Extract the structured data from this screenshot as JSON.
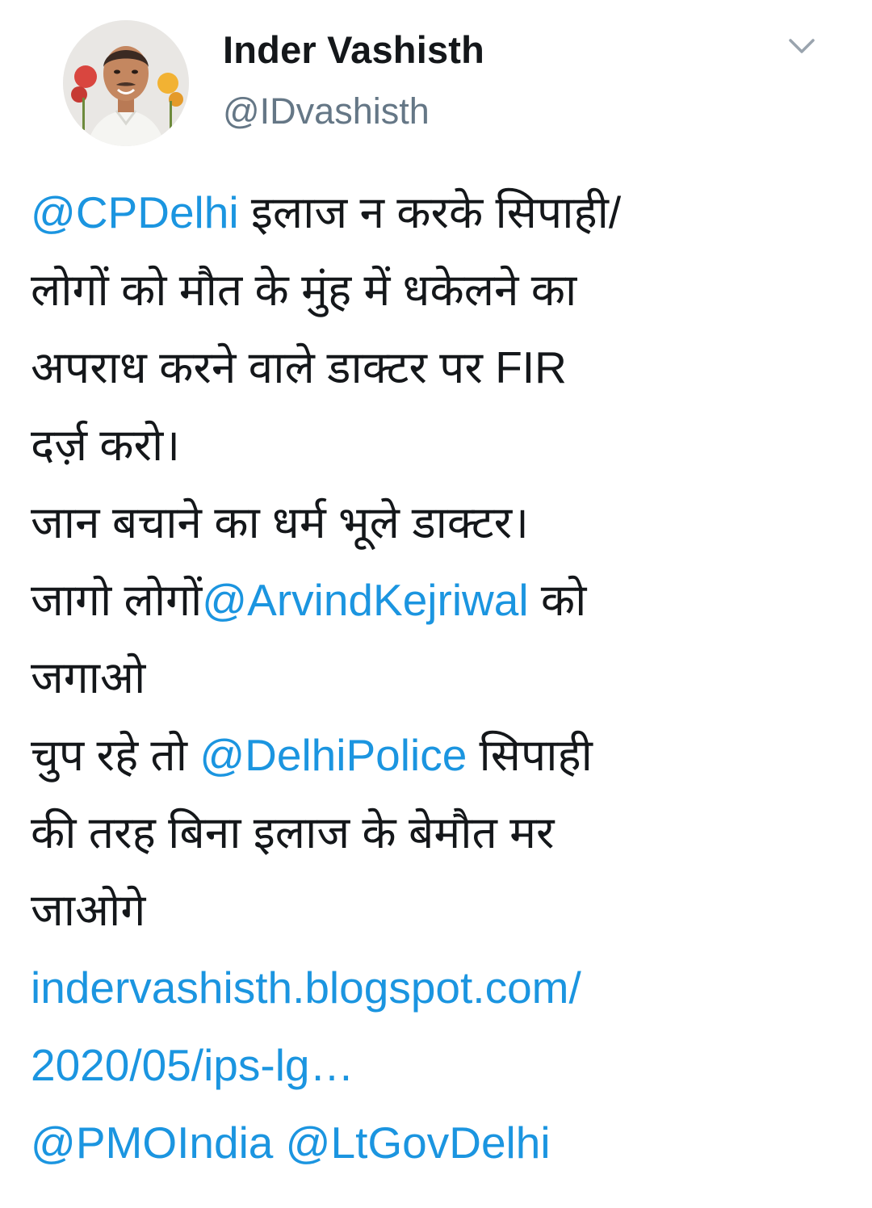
{
  "header": {
    "display_name": "Inder Vashisth",
    "handle": "@IDvashisth",
    "avatar_icon": "user-avatar-photo",
    "menu_icon": "chevron-down-icon"
  },
  "colors": {
    "link": "#1b95e0",
    "text": "#14171a",
    "secondary": "#657786"
  },
  "tweet": {
    "l1_mention": "@CPDelhi",
    "l1_text": " इलाज न करके सिपाही/",
    "l2_text": "लोगों को मौत के मुंह में धकेलने का",
    "l3_text": "अपराध करने वाले डाक्टर पर FIR",
    "l4_text": "दर्ज़ करो।",
    "l5_text": "जान बचाने का धर्म भूले डाक्टर।",
    "l6_text_a": "जागो लोगों",
    "l6_mention": "@ArvindKejriwal",
    "l6_text_b": " को",
    "l7_text": "जगाओ",
    "l8_text_a": "चुप रहे तो ",
    "l8_mention": "@DelhiPolice",
    "l8_text_b": " सिपाही",
    "l9_text": "की तरह बिना इलाज के बेमौत मर",
    "l10_text": "जाओगे",
    "l11_link": "indervashisth.blogspot.com/",
    "l12_link": "2020/05/ips-lg…",
    "l13_mention_a": "@PMOIndia",
    "l13_space": " ",
    "l13_mention_b": "@LtGovDelhi"
  }
}
